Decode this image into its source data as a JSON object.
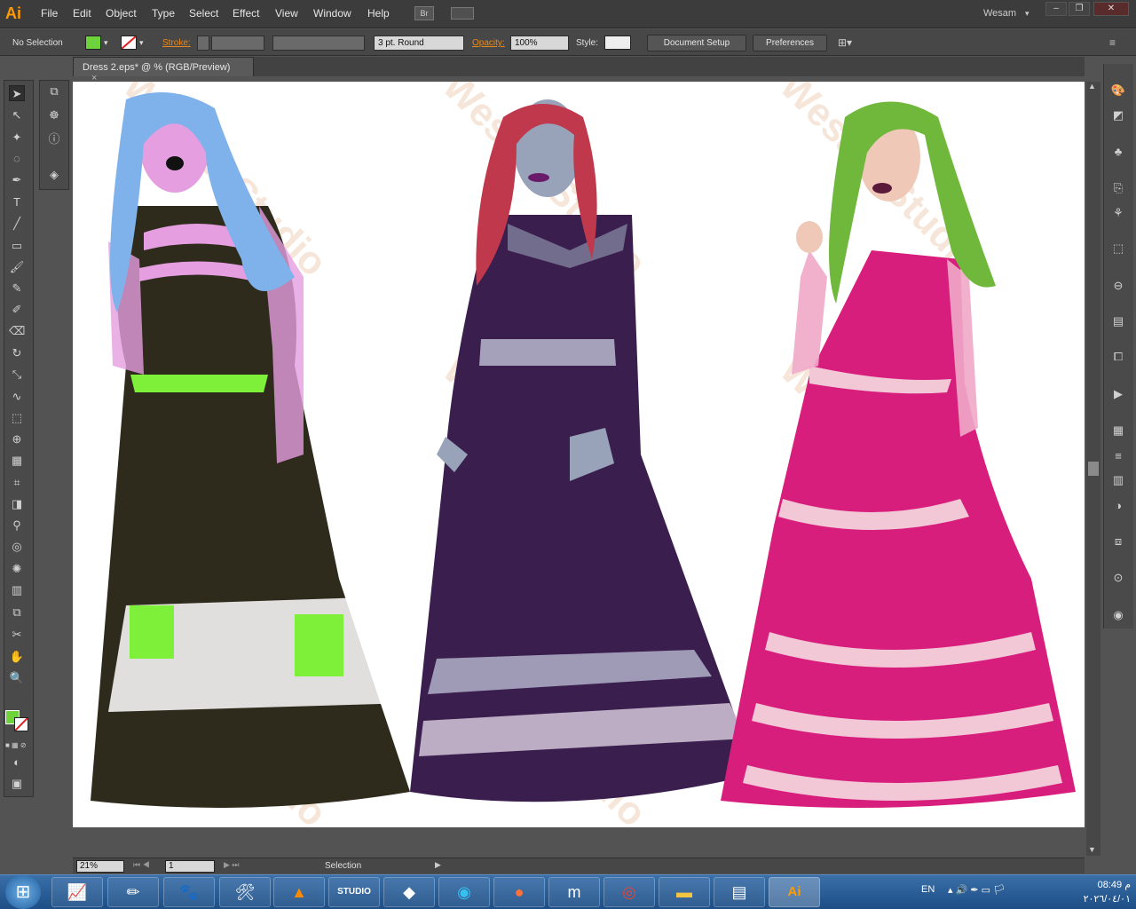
{
  "app": {
    "logo": "Ai",
    "user": "Wesam"
  },
  "menu": [
    "File",
    "Edit",
    "Object",
    "Type",
    "Select",
    "Effect",
    "View",
    "Window",
    "Help"
  ],
  "menu_extra": {
    "bridge": "Br"
  },
  "window_controls": {
    "minimize": "–",
    "restore": "❐",
    "close": "✕"
  },
  "control_bar": {
    "selection": "No Selection",
    "stroke_label": "Stroke:",
    "brush": "3 pt. Round",
    "opacity_label": "Opacity:",
    "opacity_value": "100%",
    "style_label": "Style:",
    "document_setup": "Document Setup",
    "preferences": "Preferences",
    "fill_color": "#6ed33a"
  },
  "document": {
    "tab_title": "Dress 2.eps* @ % (RGB/Preview)",
    "close": "×"
  },
  "status": {
    "zoom": "21%",
    "page": "1",
    "tool": "Selection"
  },
  "watermark": "Wesam Studio",
  "figures": [
    {
      "name": "figure-left",
      "hair": "#7fb1ea",
      "skin": "#e59ee0",
      "dress": "#2e2b1d",
      "band": "#7ef03a"
    },
    {
      "name": "figure-middle",
      "hair": "#c0384b",
      "skin": "#98a2b8",
      "dress": "#3a1e4d",
      "band": "#b9b9cf"
    },
    {
      "name": "figure-right",
      "hair": "#6fb83b",
      "skin": "#f0c8b8",
      "dress": "#d81e7d",
      "band": "#f3c8d6"
    }
  ],
  "taskbar": {
    "start": "⊞",
    "language": "EN",
    "time": "08:49 م",
    "date": "٢٠٢٦/٠٤/٠١",
    "apps": [
      "monitor",
      "paint",
      "gallery",
      "tools",
      "vlc",
      "studio",
      "maps",
      "edge",
      "firefox",
      "maxthon",
      "chrome",
      "explorer",
      "notepad",
      "illustrator"
    ]
  }
}
